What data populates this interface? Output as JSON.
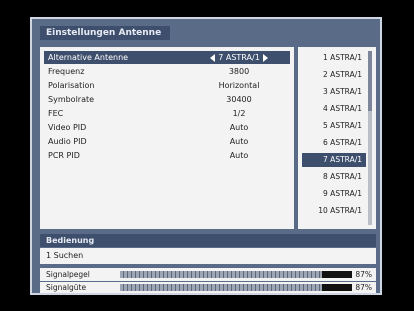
{
  "window": {
    "title": "Einstellungen Antenne"
  },
  "settings": [
    {
      "label": "Alternative Antenne",
      "value": "7 ASTRA/1",
      "selected": true
    },
    {
      "label": "Frequenz",
      "value": "3800"
    },
    {
      "label": "Polarisation",
      "value": "Horizontal"
    },
    {
      "label": "Symbolrate",
      "value": "30400"
    },
    {
      "label": "FEC",
      "value": "1/2"
    },
    {
      "label": "Video PID",
      "value": "Auto"
    },
    {
      "label": "Audio PID",
      "value": "Auto"
    },
    {
      "label": "PCR PID",
      "value": "Auto"
    }
  ],
  "antenna_list": [
    {
      "label": "1 ASTRA/1"
    },
    {
      "label": "2 ASTRA/1"
    },
    {
      "label": "3 ASTRA/1"
    },
    {
      "label": "4 ASTRA/1"
    },
    {
      "label": "5 ASTRA/1"
    },
    {
      "label": "6 ASTRA/1"
    },
    {
      "label": "7 ASTRA/1",
      "selected": true
    },
    {
      "label": "8 ASTRA/1"
    },
    {
      "label": "9 ASTRA/1"
    },
    {
      "label": "10 ASTRA/1"
    }
  ],
  "info": {
    "heading": "Bedienung",
    "text": "1 Suchen"
  },
  "meters": [
    {
      "label": "Signalpegel",
      "value": 0.87,
      "percent": "87%"
    },
    {
      "label": "Signalgüte",
      "value": 0.87,
      "percent": "87%"
    }
  ],
  "colors": {
    "accent": "#3e4f6d",
    "frame": "#5a6b87",
    "panel": "#f3f3f3"
  }
}
